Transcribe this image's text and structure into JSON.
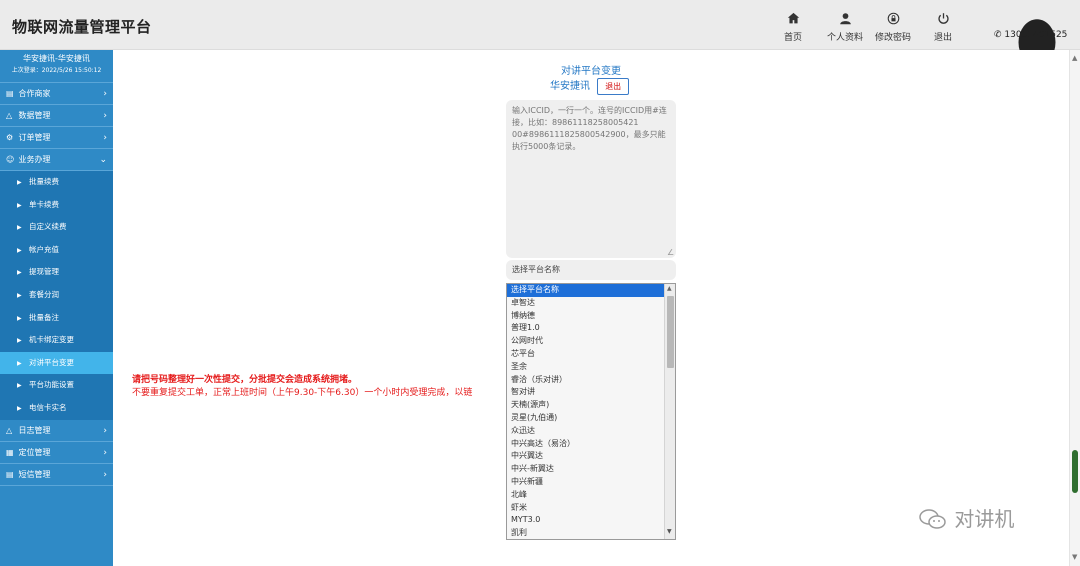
{
  "header": {
    "brand": "物联网流量管理平台",
    "nav": [
      {
        "label": "首页",
        "icon": "home-icon"
      },
      {
        "label": "个人资料",
        "icon": "user-icon"
      },
      {
        "label": "修改密码",
        "icon": "lock-icon"
      },
      {
        "label": "退出",
        "icon": "power-icon"
      }
    ],
    "phone": "13051401525",
    "phone_icon": "phone-icon",
    "qq_icon": "qq-icon"
  },
  "sidebar": {
    "user_name": "华安捷讯-华安捷讯",
    "last_login": "上次登录：2022/5/26 15:50:12",
    "menus": [
      {
        "label": "合作商家",
        "icon": "chart-icon",
        "expanded": false
      },
      {
        "label": "数据管理",
        "icon": "people-icon",
        "expanded": false
      },
      {
        "label": "订单管理",
        "icon": "settings-icon",
        "expanded": false
      },
      {
        "label": "业务办理",
        "icon": "person-icon",
        "expanded": true
      }
    ],
    "sub_items": [
      "批量续费",
      "单卡续费",
      "自定义续费",
      "帐户充值",
      "提现管理",
      "套餐分润",
      "批量备注",
      "机卡绑定变更",
      "对讲平台变更",
      "平台功能设置",
      "电信卡实名"
    ],
    "active_sub": "对讲平台变更",
    "menus_bottom": [
      {
        "label": "日志管理",
        "icon": "warning-icon"
      },
      {
        "label": "定位管理",
        "icon": "map-icon"
      },
      {
        "label": "短信管理",
        "icon": "chart-icon"
      }
    ]
  },
  "main": {
    "title": "对讲平台变更",
    "company": "华安捷讯",
    "logout_label": "退出",
    "iccid_placeholder": "输入ICCID，一行一个。连号的ICCID用#连接，比如：89861118258005421​00#89861118258005429​00，最多只能执行5000条记录。",
    "select_placeholder": "选择平台名称",
    "platform_options": [
      "选择平台名称",
      "卓智达",
      "博纳德",
      "普理1.0",
      "公网时代",
      "芯平台",
      "圣余",
      "睿洽（乐对讲）",
      "智对讲",
      "天楠(源声)",
      "灵星(九伯通)",
      "众迅达",
      "中兴高达（易洽）",
      "中兴翼达",
      "中兴-新翼达",
      "中兴新疆",
      "北峰",
      "虾米",
      "MYT3.0",
      "凯利"
    ],
    "selected_option": "选择平台名称",
    "warning_bold": "请把号码整理好一次性提交，分批提交会造成系统拥堵。",
    "warning_text": "不要重复提交工单，正常上班时间（上午9.30-下午6.30）一个小时内受理完成，以链"
  },
  "watermark": "对讲机"
}
